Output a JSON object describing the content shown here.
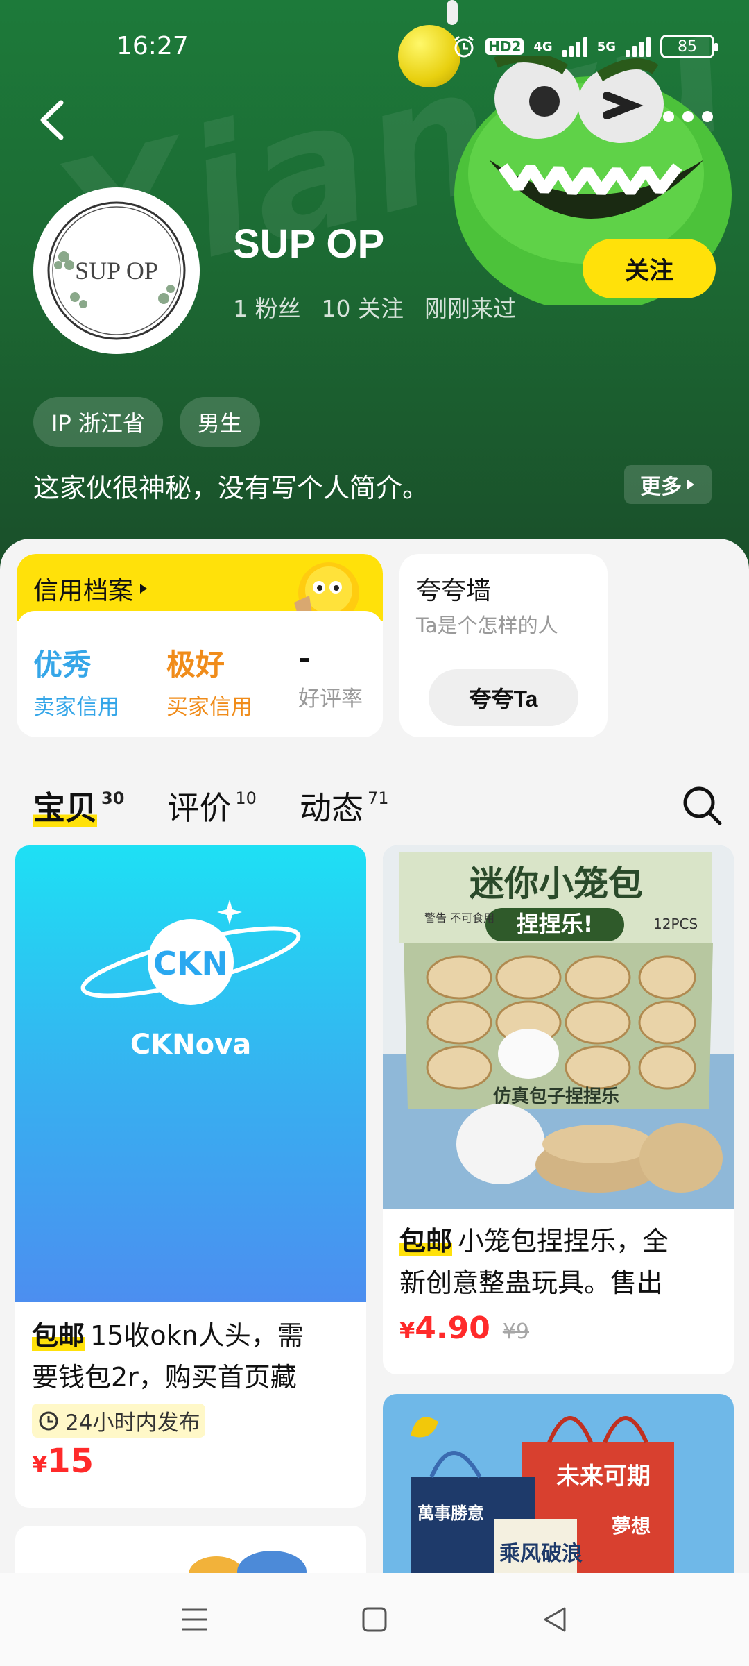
{
  "status_bar": {
    "time": "16:27",
    "hd": "HD2",
    "net1": "4G",
    "net2": "5G",
    "battery": "85"
  },
  "hero": {
    "watermark": "Xianyu"
  },
  "profile": {
    "avatar_text": "SUP OP",
    "name": "SUP OP",
    "fans": "1 粉丝",
    "following": "10 关注",
    "last_seen": "刚刚来过",
    "follow_label": "关注",
    "tags": [
      "IP 浙江省",
      "男生"
    ],
    "bio": "这家伙很神秘，没有写个人简介。",
    "bio_more": "更多"
  },
  "credit": {
    "title": "信用档案",
    "seller_value": "优秀",
    "seller_label": "卖家信用",
    "buyer_value": "极好",
    "buyer_label": "买家信用",
    "rate_value": "-",
    "rate_label": "好评率"
  },
  "praise": {
    "title": "夸夸墙",
    "subtitle": "Ta是个怎样的人",
    "button": "夸夸Ta"
  },
  "tabs": [
    {
      "label": "宝贝",
      "count": "30"
    },
    {
      "label": "评价",
      "count": "10"
    },
    {
      "label": "动态",
      "count": "71"
    }
  ],
  "items": [
    {
      "image_text": "CKNova",
      "badge": "包邮",
      "title_line1": "15收okn人头，需",
      "title_line2": "要钱包2r，购买首页藏",
      "time_tag": "24小时内发布",
      "price_symbol": "¥",
      "price": "15"
    },
    {
      "box_text_top": "迷你小笼包",
      "box_text_mid": "捏捏乐!",
      "box_text_bottom": "仿真包子捏捏乐",
      "box_warning": "警告 不可食用",
      "box_pcs": "12PCS",
      "badge": "包邮",
      "title_line1": "小笼包捏捏乐，全",
      "title_line2": "新创意整蛊玩具。售出",
      "price_symbol": "¥",
      "price": "4.90",
      "original_price": "¥9"
    },
    {
      "bag_text_1": "未来可期",
      "bag_text_2": "乘风破浪",
      "bag_text_3": "萬事勝意",
      "bag_text_4": "夢想"
    }
  ],
  "colors": {
    "brand_yellow": "#ffe10a",
    "hero_green": "#1d7a3a",
    "price_red": "#ff2a2a",
    "seller_blue": "#35a6e8",
    "buyer_orange": "#f08c1a"
  }
}
